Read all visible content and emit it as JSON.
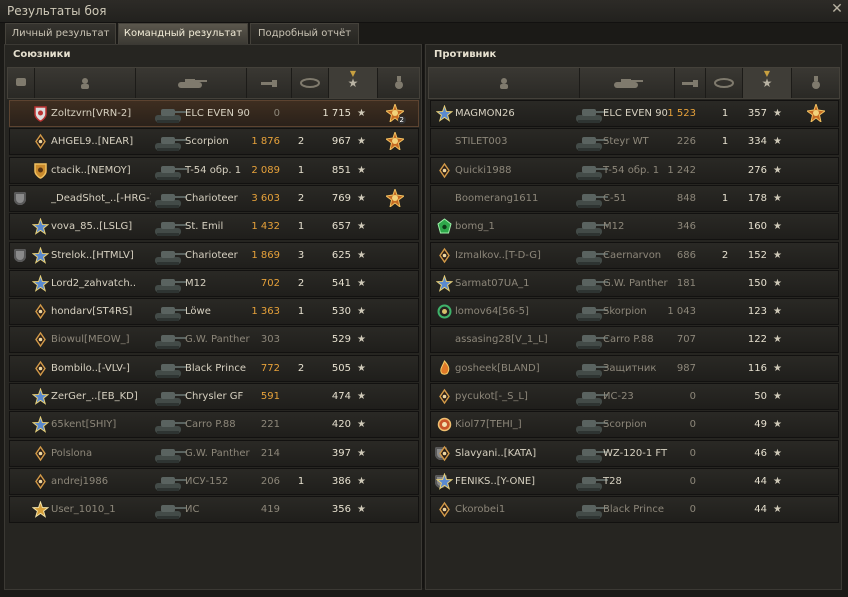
{
  "window": {
    "title": "Результаты боя"
  },
  "tabs": [
    {
      "label": "Личный результат",
      "active": false
    },
    {
      "label": "Командный результат",
      "active": true
    },
    {
      "label": "Подробный отчёт",
      "active": false
    }
  ],
  "colors": {
    "damage": "#e6a13a",
    "accent_active_tab": "#5b574d",
    "highlight_row": "#3e2e20"
  },
  "allies": {
    "title": "Союзники",
    "players": [
      {
        "name": "Zoltzvrn[VRN-2]",
        "tank": "ELC EVEN 90",
        "damage": "0",
        "frags": "",
        "xp": "1 715",
        "highlight": true,
        "medal": "master-badge-icon",
        "medal_count": "2",
        "badge": "shield-red-badge-icon",
        "dead": false,
        "premium": false
      },
      {
        "name": "AHGEL9..[NEAR]",
        "tank": "Scorpion",
        "damage": "1 876",
        "frags": "2",
        "xp": "967",
        "medal": "master-badge-icon",
        "badge": "diamond-badge-icon",
        "dead": false,
        "premium": false
      },
      {
        "name": "ctacik..[NEMOY]",
        "tank": "T-54 обр. 1",
        "damage": "2 089",
        "frags": "1",
        "xp": "851",
        "medal": "",
        "badge": "shield-gold-badge-icon",
        "dead": false,
        "premium": false
      },
      {
        "name": "_DeadShot_..[-HRG-]",
        "tank": "Charioteer",
        "damage": "3 603",
        "frags": "2",
        "xp": "769",
        "medal": "master-badge-icon",
        "badge": "",
        "dead": false,
        "premium": true
      },
      {
        "name": "vova_85..[LSLG]",
        "tank": "St. Emil",
        "damage": "1 432",
        "frags": "1",
        "xp": "657",
        "medal": "",
        "badge": "star-badge-icon",
        "dead": false,
        "premium": false
      },
      {
        "name": "Strelok..[HTMLV]",
        "tank": "Charioteer",
        "damage": "1 869",
        "frags": "3",
        "xp": "625",
        "medal": "",
        "badge": "star-badge-icon",
        "dead": false,
        "premium": true
      },
      {
        "name": "Lord2_zahvatch..",
        "tank": "M12",
        "damage": "702",
        "frags": "2",
        "xp": "541",
        "medal": "",
        "badge": "star-badge-icon",
        "dead": false,
        "premium": false
      },
      {
        "name": "hondarv[ST4RS]",
        "tank": "Löwe",
        "damage": "1 363",
        "frags": "1",
        "xp": "530",
        "medal": "",
        "badge": "diamond-badge-icon",
        "dead": false,
        "premium": false
      },
      {
        "name": "Biowul[MEOW_]",
        "tank": "G.W. Panther",
        "damage": "303",
        "frags": "",
        "xp": "529",
        "medal": "",
        "badge": "diamond-badge-icon",
        "dead": true,
        "premium": false
      },
      {
        "name": "Bombilo..[-VLV-]",
        "tank": "Black Prince",
        "damage": "772",
        "frags": "2",
        "xp": "505",
        "medal": "",
        "badge": "diamond-badge-icon",
        "dead": false,
        "premium": false
      },
      {
        "name": "ZerGer_..[EB_KD]",
        "tank": "Chrysler GF",
        "damage": "591",
        "frags": "",
        "xp": "474",
        "medal": "",
        "badge": "star-badge-icon",
        "dead": false,
        "premium": false
      },
      {
        "name": "65kent[SHIY]",
        "tank": "Carro P.88",
        "damage": "221",
        "frags": "",
        "xp": "420",
        "medal": "",
        "badge": "star-badge-icon",
        "dead": true,
        "premium": false
      },
      {
        "name": "Polslona",
        "tank": "G.W. Panther",
        "damage": "214",
        "frags": "",
        "xp": "397",
        "medal": "",
        "badge": "diamond-badge-icon",
        "dead": true,
        "premium": false
      },
      {
        "name": "andrej1986",
        "tank": "ИСУ-152",
        "damage": "206",
        "frags": "1",
        "xp": "386",
        "medal": "",
        "badge": "diamond-badge-icon",
        "dead": true,
        "premium": false
      },
      {
        "name": "User_1010_1",
        "tank": "ИС",
        "damage": "419",
        "frags": "",
        "xp": "356",
        "medal": "",
        "badge": "star-gold-badge-icon",
        "dead": true,
        "premium": false
      }
    ]
  },
  "enemies": {
    "title": "Противник",
    "players": [
      {
        "name": "MAGMON26",
        "tank": "ELC EVEN 90",
        "damage": "1 523",
        "frags": "1",
        "xp": "357",
        "medal": "master-badge-icon",
        "badge": "star-badge-icon",
        "dead": false,
        "premium": false
      },
      {
        "name": "STILET003",
        "tank": "Steyr WT",
        "damage": "226",
        "frags": "1",
        "xp": "334",
        "medal": "",
        "badge": "",
        "dead": true,
        "premium": false
      },
      {
        "name": "Quicki1988",
        "tank": "T-54 обр. 1",
        "damage": "1 242",
        "frags": "",
        "xp": "276",
        "medal": "",
        "badge": "diamond-badge-icon",
        "dead": true,
        "premium": false
      },
      {
        "name": "Boomerang1611",
        "tank": "C-51",
        "damage": "848",
        "frags": "1",
        "xp": "178",
        "medal": "",
        "badge": "",
        "dead": true,
        "premium": false
      },
      {
        "name": "bomg_1",
        "tank": "M12",
        "damage": "346",
        "frags": "",
        "xp": "160",
        "medal": "",
        "badge": "green-badge-icon",
        "dead": true,
        "premium": false
      },
      {
        "name": "Izmalkov..[T-D-G]",
        "tank": "Caernarvon",
        "damage": "686",
        "frags": "2",
        "xp": "152",
        "medal": "",
        "badge": "diamond-badge-icon",
        "dead": true,
        "premium": false
      },
      {
        "name": "Sarmat07UA_1",
        "tank": "G.W. Panther",
        "damage": "181",
        "frags": "",
        "xp": "150",
        "medal": "",
        "badge": "star-badge-icon",
        "dead": true,
        "premium": false
      },
      {
        "name": "lomov64[56-5]",
        "tank": "Skorpion",
        "damage": "1 043",
        "frags": "",
        "xp": "123",
        "medal": "",
        "badge": "green-ring-badge-icon",
        "dead": true,
        "premium": false
      },
      {
        "name": "assasing28[V_1_L]",
        "tank": "Carro P.88",
        "damage": "707",
        "frags": "",
        "xp": "122",
        "medal": "",
        "badge": "",
        "dead": true,
        "premium": false
      },
      {
        "name": "gosheek[BLAND]",
        "tank": "Защитник",
        "damage": "987",
        "frags": "",
        "xp": "116",
        "medal": "",
        "badge": "flame-badge-icon",
        "dead": true,
        "premium": false
      },
      {
        "name": "pycukot[-_S_L]",
        "tank": "ИС-23",
        "damage": "0",
        "frags": "",
        "xp": "50",
        "medal": "",
        "badge": "diamond-badge-icon",
        "dead": true,
        "premium": false
      },
      {
        "name": "Kiol77[TEHI_]",
        "tank": "Scorpion",
        "damage": "0",
        "frags": "",
        "xp": "49",
        "medal": "",
        "badge": "ring-badge-icon",
        "dead": true,
        "premium": false
      },
      {
        "name": "Slavyani..[KATA]",
        "tank": "WZ-120-1 FT",
        "damage": "0",
        "frags": "",
        "xp": "46",
        "medal": "",
        "badge": "diamond-badge-icon",
        "dead": false,
        "premium": true
      },
      {
        "name": "FENIKS..[Y-ONE]",
        "tank": "T28",
        "damage": "0",
        "frags": "",
        "xp": "44",
        "medal": "",
        "badge": "star-badge-icon",
        "dead": false,
        "premium": true
      },
      {
        "name": "Ckorobei1",
        "tank": "Black Prince",
        "damage": "0",
        "frags": "",
        "xp": "44",
        "medal": "",
        "badge": "diamond-badge-icon",
        "dead": true,
        "premium": false
      }
    ]
  }
}
